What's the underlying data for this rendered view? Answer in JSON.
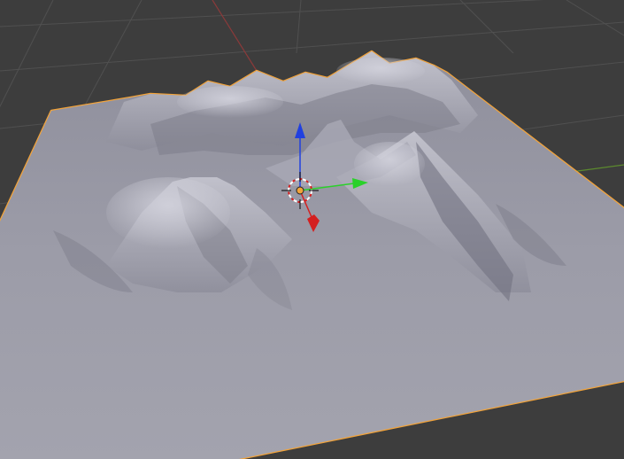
{
  "viewport": {
    "view": "3D Viewport",
    "background_color": "#3d3d3d",
    "grid_color": "#505050",
    "x_axis_color": "#8a3a3a",
    "y_axis_color": "#5c8a2e"
  },
  "object": {
    "type": "terrain-mesh",
    "selected": true,
    "outline_color": "#f2a33a",
    "surface_color": "#9a9aa6"
  },
  "gizmo": {
    "type": "translate",
    "x_arrow_color": "#d42020",
    "y_arrow_color": "#2ad12a",
    "z_arrow_color": "#2040e0",
    "cursor": "3d-cursor-icon"
  }
}
